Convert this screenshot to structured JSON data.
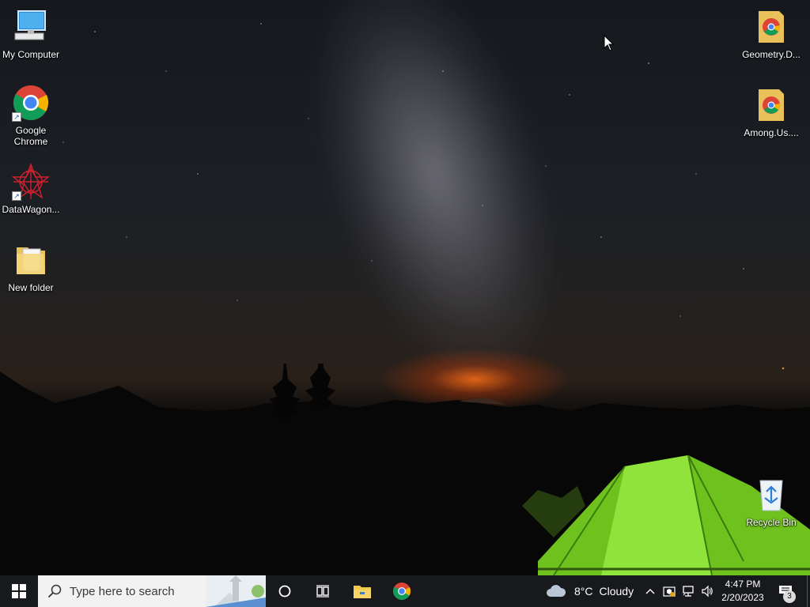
{
  "desktop": {
    "icons": [
      {
        "id": "my-computer",
        "label": "My Computer"
      },
      {
        "id": "google-chrome",
        "label": "Google\nChrome"
      },
      {
        "id": "datawagon",
        "label": "DataWagon..."
      },
      {
        "id": "new-folder",
        "label": "New folder"
      },
      {
        "id": "geometry",
        "label": "Geometry.D..."
      },
      {
        "id": "among-us",
        "label": "Among.Us...."
      },
      {
        "id": "recycle-bin",
        "label": "Recycle Bin"
      }
    ]
  },
  "taskbar": {
    "search_placeholder": "Type here to search",
    "weather": {
      "temp": "8°C",
      "condition": "Cloudy"
    },
    "clock": {
      "time": "4:47 PM",
      "date": "2/20/2023"
    },
    "notification_count": "3",
    "pinned": [
      "cortana-icon",
      "task-view-icon",
      "file-explorer-icon",
      "chrome-icon"
    ],
    "tray_icons": [
      "chevron-up-icon",
      "security-icon",
      "network-icon",
      "volume-icon"
    ]
  },
  "colors": {
    "taskbar_bg": "#17191c",
    "search_bg": "#f2f2f2",
    "tent_green": "#7fd62a",
    "horizon_orange": "#ff6e14"
  }
}
